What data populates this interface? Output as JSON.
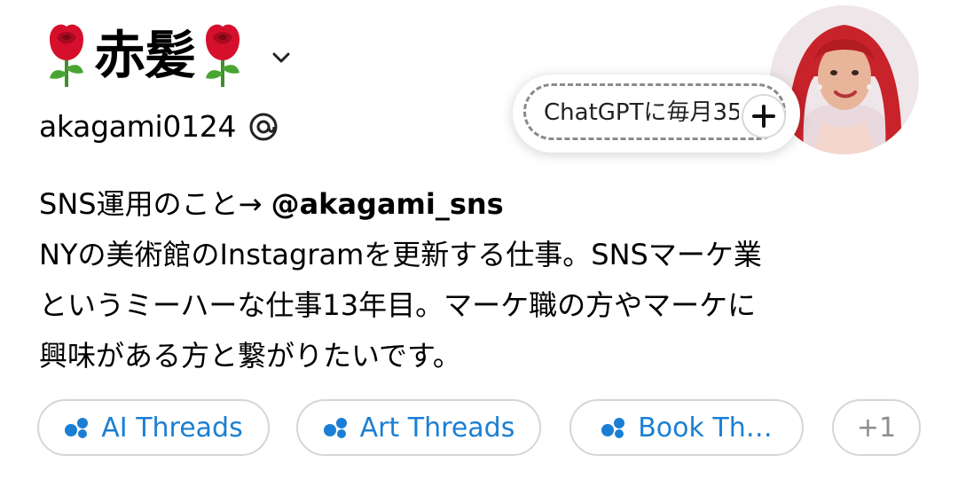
{
  "profile": {
    "display_name": "赤髪",
    "username": "akagami0124",
    "bio_lines": [
      {
        "prefix": "SNS運用のこと→ ",
        "mention": "@akagami_sns"
      },
      {
        "text": "NYの美術館のInstagramを更新する仕事。SNSマーケ業"
      },
      {
        "text": "というミーハーな仕事13年目。マーケ職の方やマーケに"
      },
      {
        "text": "興味がある方と繋がりたいです。"
      }
    ]
  },
  "note": {
    "text": "ChatGPTに毎月35"
  },
  "chips": [
    {
      "label": "AI Threads"
    },
    {
      "label": "Art Threads"
    },
    {
      "label": "Book Th…"
    },
    {
      "label": "+1"
    }
  ],
  "colors": {
    "accent": "#1a7fd4",
    "rose": "#d6102c",
    "chip_border": "#d6d6d6"
  },
  "icons": {
    "rose": "rose-emoji",
    "chevron": "chevron-down-icon",
    "threads": "threads-icon",
    "plus": "plus-icon",
    "chip": "threads-dots-icon"
  }
}
